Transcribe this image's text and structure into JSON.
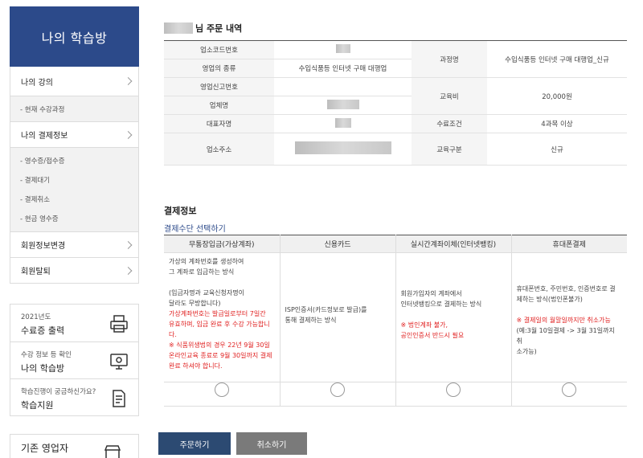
{
  "sidebar": {
    "title": "나의 학습방",
    "menu": [
      {
        "label": "나의 강의"
      },
      {
        "label": "- 현재 수강과정",
        "sub": true
      },
      {
        "label": "나의 결제정보"
      }
    ],
    "payment_sub": [
      "- 영수증/접수증",
      "- 결제대기",
      "- 결제취소",
      "- 현금 영수증"
    ],
    "menu_after": [
      {
        "label": "회원정보변경"
      },
      {
        "label": "회원탈퇴"
      }
    ],
    "quick": [
      {
        "small": "2021년도",
        "big": "수료증 출력",
        "icon": "printer-icon"
      },
      {
        "small": "수강 정보 등 확인",
        "big": "나의 학습방",
        "icon": "monitor-icon"
      },
      {
        "small": "학습진행이 궁금하신가요?",
        "big": "학습지원",
        "icon": "document-icon"
      }
    ],
    "quick2": {
      "big": "기존 영업자",
      "icon": "shop-icon"
    }
  },
  "order": {
    "title_suffix": "님 주문 내역",
    "rows": [
      {
        "label": "업소코드번호",
        "value": ""
      },
      {
        "label": "영업의 종류",
        "value": "수입식품등 인터넷 구매 대행업"
      },
      {
        "label": "영업신고번호",
        "value": ""
      },
      {
        "label": "업체명",
        "value": ""
      },
      {
        "label": "대표자명",
        "value": ""
      },
      {
        "label": "업소주소",
        "value": ""
      }
    ],
    "course_label": "과정명",
    "course_value": "수입식품등 인터넷 구매 대행업_신규",
    "fee_label": "교육비",
    "fee_value": "20,000원",
    "completion_label": "수료조건",
    "completion_value": "4과목 이상",
    "category_label": "교육구분",
    "category_value": "신규"
  },
  "payment": {
    "title": "결제정보",
    "subtitle": "결제수단 선택하기",
    "methods": [
      {
        "header": "무통장입금(가상계좌)",
        "lines": [
          {
            "text": "가상의 계좌번호를 생성하여"
          },
          {
            "text": "그 계좌로 입금하는 방식"
          },
          {
            "text": ""
          },
          {
            "text": "(입금자명과 교육신청자명이"
          },
          {
            "text": "달라도 무방합니다)"
          },
          {
            "text": "가상계좌번호는 발급일로부터 7일간",
            "red": true
          },
          {
            "text": "유효하며, 입금 완료 후 수강 가능합니",
            "red": true
          },
          {
            "text": "다.",
            "red": true
          },
          {
            "text": "※ 식품위생법의 경우 22년 9월 30일",
            "red": true
          },
          {
            "text": "온라인교육 종료로 9월 30일까지 결제",
            "red": true
          },
          {
            "text": "완료 하셔야 합니다.",
            "red": true
          }
        ]
      },
      {
        "header": "신용카드",
        "lines": [
          {
            "text": "ISP인증서(카드정보로 발급)를"
          },
          {
            "text": "통해 결제하는 방식"
          }
        ]
      },
      {
        "header": "실시간계좌이체(인터넷뱅킹)",
        "lines": [
          {
            "text": "회원가입자의 계좌에서"
          },
          {
            "text": "인터넷뱅킹으로 결제하는 방식"
          },
          {
            "text": ""
          },
          {
            "text": "※ 법인계좌 불가,",
            "red": true
          },
          {
            "text": "공인인증서 반드시 필요",
            "red": true
          }
        ]
      },
      {
        "header": "휴대폰결제",
        "lines": [
          {
            "text": "휴대폰번호, 주민번호, 인증번호로 결"
          },
          {
            "text": "제하는 방식(법인폰불가)"
          },
          {
            "text": ""
          },
          {
            "text": "※ 결제일의 월말일까지만 취소가능",
            "red": true
          },
          {
            "text": "(예:3월 10일결제 -> 3월 31일까지 취"
          },
          {
            "text": "소가능)"
          }
        ]
      }
    ]
  },
  "buttons": {
    "order": "주문하기",
    "cancel": "취소하기"
  }
}
